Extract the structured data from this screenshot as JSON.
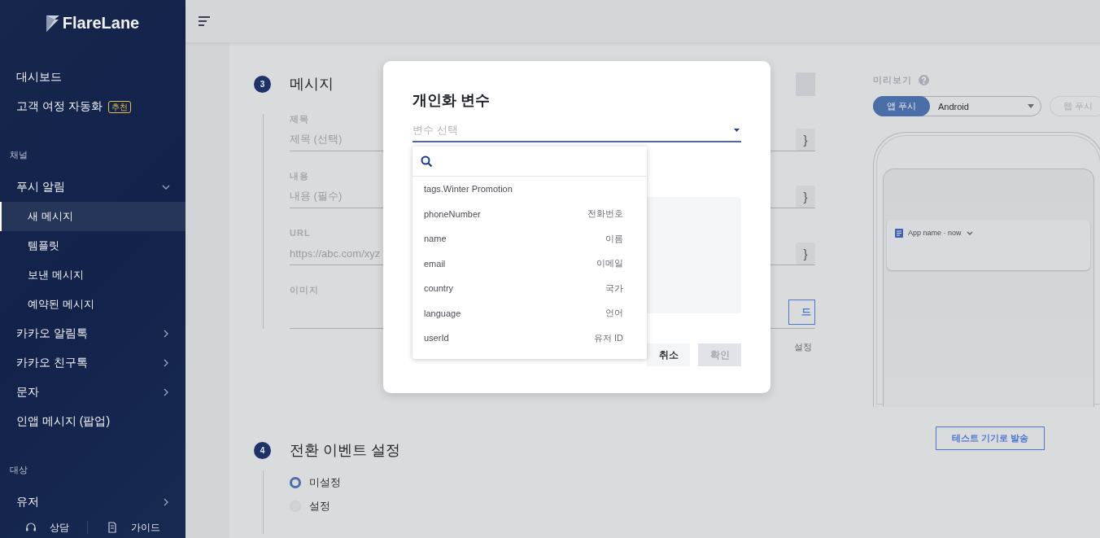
{
  "logo": {
    "text": "FlareLane"
  },
  "sidebar": {
    "top_items": [
      {
        "label": "대시보드",
        "selected": false
      },
      {
        "label": "고객 여정 자동화",
        "badge": "추천",
        "selected": false
      }
    ],
    "sections": [
      {
        "title": "채널",
        "items": [
          {
            "label": "푸시 알림",
            "expanded": true,
            "selected": false,
            "children": [
              {
                "label": "새 메시지",
                "selected": true
              },
              {
                "label": "템플릿",
                "selected": false
              },
              {
                "label": "보낸 메시지",
                "selected": false
              },
              {
                "label": "예약된 메시지",
                "selected": false
              }
            ]
          },
          {
            "label": "카카오 알림톡",
            "expanded": false,
            "selected": false
          },
          {
            "label": "카카오 친구톡",
            "expanded": false,
            "selected": false
          },
          {
            "label": "문자",
            "expanded": false,
            "selected": false
          },
          {
            "label": "인앱 메시지 (팝업)",
            "selected": false
          }
        ]
      },
      {
        "title": "대상",
        "items": [
          {
            "label": "유저",
            "expanded": false,
            "selected": false
          }
        ]
      }
    ],
    "footer": [
      {
        "label": "상담",
        "kind": "headset"
      },
      {
        "label": "가이드",
        "kind": "guide"
      }
    ]
  },
  "steps": [
    {
      "number": "3",
      "title": "메시지",
      "fields": [
        {
          "kind": "text",
          "label": "제목",
          "placeholder": "제목 (선택)",
          "button": "}"
        },
        {
          "kind": "text",
          "label": "내용",
          "placeholder": "내용 (필수)",
          "button": "}"
        },
        {
          "kind": "text",
          "label": "URL",
          "placeholder": "https://abc.com/xyz",
          "button": "}"
        },
        {
          "kind": "image",
          "label": "이미지",
          "button": "드",
          "note": "설정"
        }
      ]
    },
    {
      "number": "4",
      "title": "전환 이벤트 설정",
      "options": [
        {
          "label": "미설정",
          "selected": true
        },
        {
          "label": "설정",
          "selected": false
        }
      ]
    }
  ],
  "preview": {
    "title": "미리보기",
    "platform_tabs": [
      {
        "label": "앱 푸시",
        "selected": true
      },
      {
        "label": "웹 푸시",
        "selected": false
      }
    ],
    "device_select": {
      "value": "Android"
    },
    "notification": {
      "header": "App name · now"
    },
    "test_button": "테스트 기기로 발송"
  },
  "modal": {
    "title": "개인화 변수",
    "select": {
      "placeholder": "변수 선택"
    },
    "options": [
      {
        "key": "tags.Winter Promotion",
        "selected": false
      },
      {
        "key": "phoneNumber",
        "label": "전화번호",
        "selected": false
      },
      {
        "key": "name",
        "label": "이름",
        "selected": false
      },
      {
        "key": "email",
        "label": "이메일",
        "selected": false
      },
      {
        "key": "country",
        "label": "국가",
        "selected": false
      },
      {
        "key": "language",
        "label": "언어",
        "selected": false
      },
      {
        "key": "userId",
        "label": "유저 ID",
        "selected": false
      }
    ],
    "buttons": [
      {
        "label": "취소",
        "disabled": false
      },
      {
        "label": "확인",
        "disabled": true
      }
    ]
  }
}
